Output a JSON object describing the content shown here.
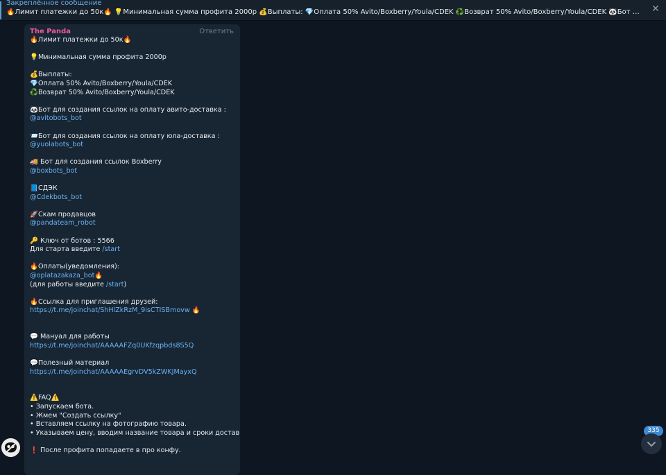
{
  "pinned": {
    "title": "Закреплённое сообщение",
    "text": "🔥Лимит платежки до 50к🔥 💡Минимальная сумма профита 2000р 💰Выплаты: 💎Оплата 50% Avito/Boxberry/Youla/CDEK ♻️Возврат 50% Avito/Boxberry/Youla/CDEK 🐼Бот для создания ссылок ...",
    "close_glyph": "✕"
  },
  "message": {
    "sender": "The Panda",
    "reply_label": "Ответить",
    "lines": [
      "🔥Лимит платежки до 50к🔥",
      "",
      "💡Минимальная сумма профита 2000р",
      "",
      "💰Выплаты:",
      "💎Оплата 50% Avito/Boxberry/Youla/CDEK",
      "♻️Возврат 50% Avito/Boxberry/Youla/CDEK",
      "",
      "🐼Бот для создания ссылок на оплату авито-доставка :",
      "@avitobots_bot",
      "",
      "📨Бот для создания ссылок на оплату юла-доставка :",
      "@yuolabots_bot",
      "",
      "🚚 Бот для создания ссылок Boxberry",
      "@boxbots_bot",
      "",
      "📘СДЭК",
      "@Cdekbots_bot",
      "",
      "🚀Скам продавцов",
      "@pandateam_robot",
      "",
      "🔑 Ключ от ботов : 5566",
      "Для старта введите /start",
      "",
      "🔥Оплаты(уведомления):",
      "@oplatazakaza_bot🔥",
      "(для работы введите /start)",
      "",
      "🔥Ссылка для приглашения друзей:",
      "https://t.me/joinchat/ShHlZkRzM_9isCTISBmovw 🔥",
      "",
      "",
      "💬 Мануал для работы",
      "https://t.me/joinchat/AAAAAFZq0UKfzqpbds8S5Q",
      "",
      "💬Полезный материал",
      "https://t.me/joinchat/AAAAAEgrvDV5kZWKJMayxQ",
      "",
      "",
      "⚠️FAQ⚠️",
      "• Запускаем бота.",
      "• Жмем \"Создать ссылку\"",
      "• Вставляем ссылку на фотографию товара.",
      "• Указываем цену, вводим название товара и сроки доставки.",
      "",
      "❗ После профита попадаете в про конфу."
    ]
  },
  "unread_count": "335",
  "colors": {
    "background": "#0e1621",
    "bubble": "#182533",
    "link": "#6ab3f3",
    "sender": "#ef5b9c",
    "badge": "#3f8ad1"
  }
}
